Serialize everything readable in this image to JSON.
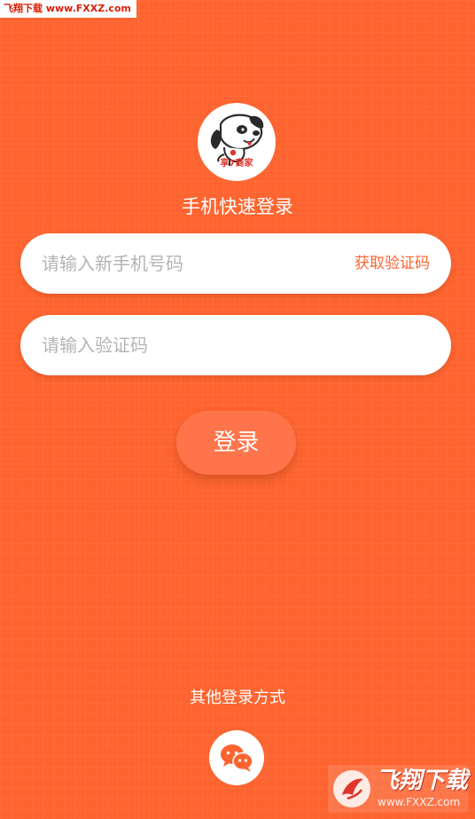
{
  "watermark": {
    "top_text": "飞翔下载 www.FXXZ.com",
    "bottom_brand": "飞翔下载",
    "bottom_url": "www.FXXZ.com"
  },
  "logo": {
    "icon": "dog-mascot-icon",
    "text": "享7商家"
  },
  "page": {
    "title": "手机快速登录"
  },
  "form": {
    "phone_placeholder": "请输入新手机号码",
    "get_code_label": "获取验证码",
    "code_placeholder": "请输入验证码",
    "login_label": "登录"
  },
  "other_login": {
    "label": "其他登录方式",
    "wechat_icon": "wechat-icon"
  },
  "colors": {
    "background": "#fd6430",
    "accent": "#fd6430",
    "button": "#ff744a",
    "placeholder": "#b4b4b4",
    "wechat": "#fd6430"
  }
}
